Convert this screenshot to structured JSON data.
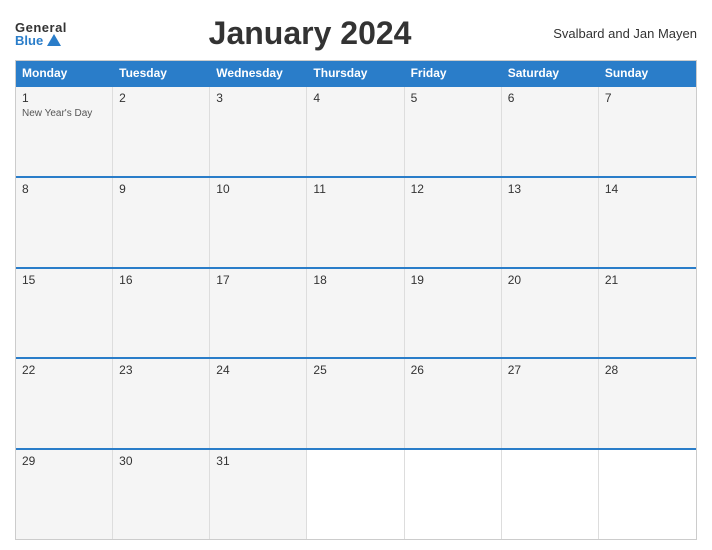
{
  "logo": {
    "general": "General",
    "blue": "Blue"
  },
  "title": "January 2024",
  "region": "Svalbard and Jan Mayen",
  "dayHeaders": [
    "Monday",
    "Tuesday",
    "Wednesday",
    "Thursday",
    "Friday",
    "Saturday",
    "Sunday"
  ],
  "weeks": [
    [
      {
        "num": "1",
        "event": "New Year's Day"
      },
      {
        "num": "2",
        "event": ""
      },
      {
        "num": "3",
        "event": ""
      },
      {
        "num": "4",
        "event": ""
      },
      {
        "num": "5",
        "event": ""
      },
      {
        "num": "6",
        "event": ""
      },
      {
        "num": "7",
        "event": ""
      }
    ],
    [
      {
        "num": "8",
        "event": ""
      },
      {
        "num": "9",
        "event": ""
      },
      {
        "num": "10",
        "event": ""
      },
      {
        "num": "11",
        "event": ""
      },
      {
        "num": "12",
        "event": ""
      },
      {
        "num": "13",
        "event": ""
      },
      {
        "num": "14",
        "event": ""
      }
    ],
    [
      {
        "num": "15",
        "event": ""
      },
      {
        "num": "16",
        "event": ""
      },
      {
        "num": "17",
        "event": ""
      },
      {
        "num": "18",
        "event": ""
      },
      {
        "num": "19",
        "event": ""
      },
      {
        "num": "20",
        "event": ""
      },
      {
        "num": "21",
        "event": ""
      }
    ],
    [
      {
        "num": "22",
        "event": ""
      },
      {
        "num": "23",
        "event": ""
      },
      {
        "num": "24",
        "event": ""
      },
      {
        "num": "25",
        "event": ""
      },
      {
        "num": "26",
        "event": ""
      },
      {
        "num": "27",
        "event": ""
      },
      {
        "num": "28",
        "event": ""
      }
    ],
    [
      {
        "num": "29",
        "event": ""
      },
      {
        "num": "30",
        "event": ""
      },
      {
        "num": "31",
        "event": ""
      },
      {
        "num": "",
        "event": ""
      },
      {
        "num": "",
        "event": ""
      },
      {
        "num": "",
        "event": ""
      },
      {
        "num": "",
        "event": ""
      }
    ]
  ]
}
